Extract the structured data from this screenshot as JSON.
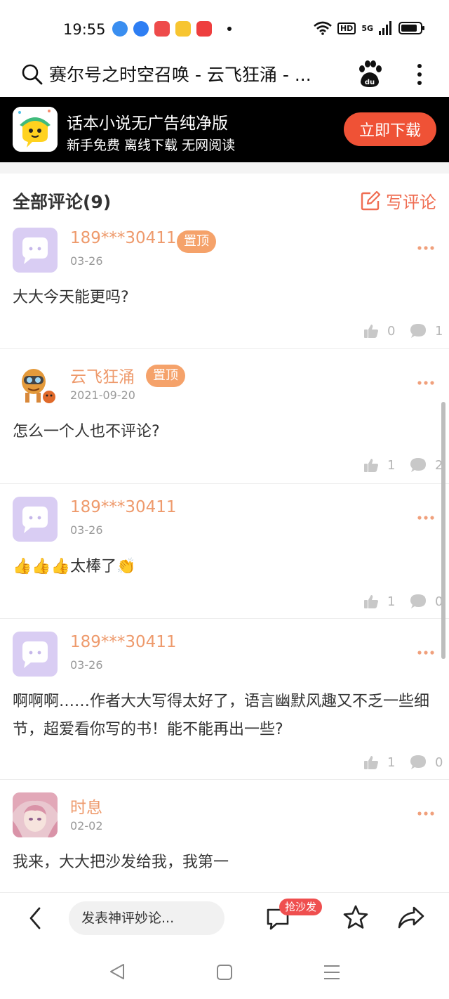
{
  "status_bar": {
    "time": "19:55",
    "hd": "HD",
    "network": "5G",
    "battery_level": 0.85,
    "apps": [
      {
        "name": "browser-app-icon",
        "color": "#3a8ef0"
      },
      {
        "name": "baidu-app-icon",
        "color": "#2e7ef3"
      },
      {
        "name": "music-app-icon",
        "color": "#ee4b4b"
      },
      {
        "name": "notes-app-icon",
        "color": "#f7c531"
      },
      {
        "name": "video-app-icon",
        "color": "#ee3e3e"
      }
    ]
  },
  "address_bar": {
    "title": "赛尔号之时空召唤 - 云飞狂涌 - ..."
  },
  "ad": {
    "title": "话本小说无广告纯净版",
    "subtitle": "新手免费 离线下载 无网阅读",
    "button": "立即下载"
  },
  "comments_header": {
    "title": "全部评论(9)",
    "write_label": "写评论"
  },
  "pin_label": "置顶",
  "comments": [
    {
      "username": "189***30411",
      "pinned": true,
      "date": "03-26",
      "content": "大大今天能更吗?",
      "likes": "0",
      "replies": "1",
      "avatar": "purple"
    },
    {
      "username": "云飞狂涌",
      "pinned": true,
      "date": "2021-09-20",
      "content": "怎么一个人也不评论?",
      "likes": "1",
      "replies": "2",
      "avatar": "robot"
    },
    {
      "username": "189***30411",
      "pinned": false,
      "date": "03-26",
      "content": "👍👍👍太棒了👏",
      "likes": "1",
      "replies": "0",
      "avatar": "purple"
    },
    {
      "username": "189***30411",
      "pinned": false,
      "date": "03-26",
      "content": "啊啊啊……作者大大写得太好了，语言幽默风趣又不乏一些细节，超爱看你写的书！能不能再出一些?",
      "likes": "1",
      "replies": "0",
      "avatar": "purple"
    },
    {
      "username": "时息",
      "pinned": false,
      "date": "02-02",
      "content": "我来，大大把沙发给我，我第一",
      "likes": "",
      "replies": "",
      "avatar": "anime"
    }
  ],
  "bottom_bar": {
    "input_placeholder": "发表神评妙论...",
    "sofa_badge": "抢沙发"
  },
  "colors": {
    "accent": "#ef6d52",
    "username": "#ee9a6c",
    "pin_badge": "#f5a26a",
    "ad_button": "#ef5236",
    "avatar_purple": "#d9cdf3"
  }
}
